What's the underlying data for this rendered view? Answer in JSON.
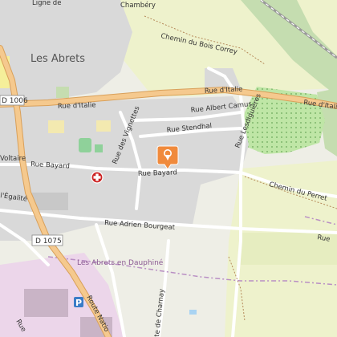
{
  "map": {
    "place_name": "Les Abrets",
    "commune_boundary_label": "Les Abrets en Dauphiné",
    "label_ligne": "Ligne de",
    "label_chambery": "Chambéry",
    "colors": {
      "background": "#eeeee6",
      "residential": "#d9d9d9",
      "greenfield": "#eef2cc",
      "forest": "#c5ddb0",
      "orchard": "#bfe6a6",
      "industrial": "#ecd6ea",
      "main_road": "#f5c98e",
      "main_road_casing": "#d9a05a",
      "minor_road": "#ffffff",
      "boundary": "#b98fc4",
      "water": "#a9d3f2",
      "pin": "#f08a3c",
      "pharmacy": "#cc2222"
    },
    "roads": {
      "rue_italie_west": "Rue d'Italie",
      "rue_italie_east": "Rue d'Italie",
      "rue_italie_far_east": "Rue d'Italie",
      "d1006": "D 1006",
      "d1075": "D 1075",
      "chemin_bois_correy": "Chemin du Bois Correy",
      "rue_albert_camus": "Rue Albert Camus",
      "rue_stendhal": "Rue Stendhal",
      "rue_lesdiguieres": "Rue Lesdiguières",
      "rue_vignettes": "Rue des Vignettes",
      "rue_voltaire": "Voltaire",
      "rue_bayard_west": "Rue Bayard",
      "rue_bayard_east": "Rue Bayard",
      "rue_egalite": "l'Égalité",
      "chemin_perret": "Chemin du Perret",
      "rue_adrien_bourgeat": "Rue Adrien Bourgeat",
      "route_nationale": "Route Natio",
      "route_charnay": "te de Charnay",
      "rue_south": "Rue"
    },
    "icons": {
      "location_pin": "location-pin-icon",
      "pharmacy": "pharmacy-cross-icon",
      "parking": "parking-icon",
      "parking_letter": "P"
    }
  }
}
